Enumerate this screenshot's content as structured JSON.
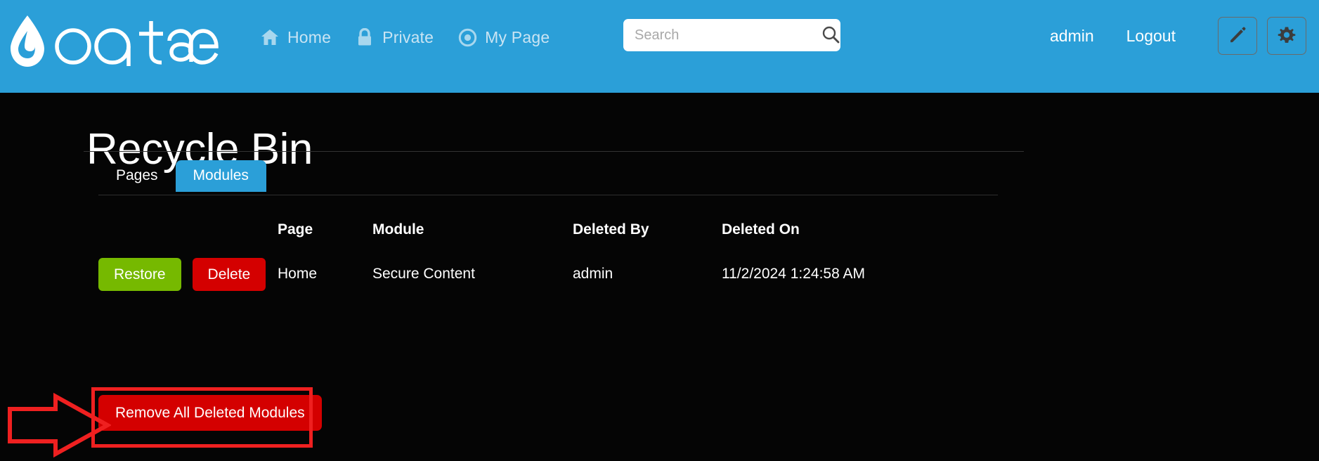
{
  "header": {
    "logo_text": "oqtane",
    "logo_icon": "water-drop-icon",
    "nav": [
      {
        "label": "Home",
        "icon": "home-icon"
      },
      {
        "label": "Private",
        "icon": "lock-icon"
      },
      {
        "label": "My Page",
        "icon": "target-icon"
      }
    ],
    "search": {
      "placeholder": "Search",
      "value": "",
      "icon": "search-icon"
    },
    "user": "admin",
    "logout": "Logout",
    "edit_icon": "pencil-icon",
    "settings_icon": "gear-icon",
    "bg_color": "#2b9fd8"
  },
  "page": {
    "title": "Recycle Bin"
  },
  "tabs": [
    {
      "label": "Pages",
      "active": false
    },
    {
      "label": "Modules",
      "active": true
    }
  ],
  "table": {
    "headers": [
      "",
      "Page",
      "Module",
      "Deleted By",
      "Deleted On"
    ],
    "rows": [
      {
        "restore_label": "Restore",
        "delete_label": "Delete",
        "page": "Home",
        "module": "Secure Content",
        "deleted_by": "admin",
        "deleted_on": "11/2/2024 1:24:58 AM"
      }
    ]
  },
  "actions": {
    "remove_all_label": "Remove All Deleted Modules"
  },
  "annotation": {
    "color": "#ef2020",
    "arrow_icon": "right-arrow-annotation",
    "highlight_target": "remove-all-deleted-modules-button"
  },
  "colors": {
    "accent": "#2b9fd8",
    "background": "#050505",
    "restore": "#76b900",
    "delete": "#d40000",
    "annotation": "#ef2020"
  }
}
